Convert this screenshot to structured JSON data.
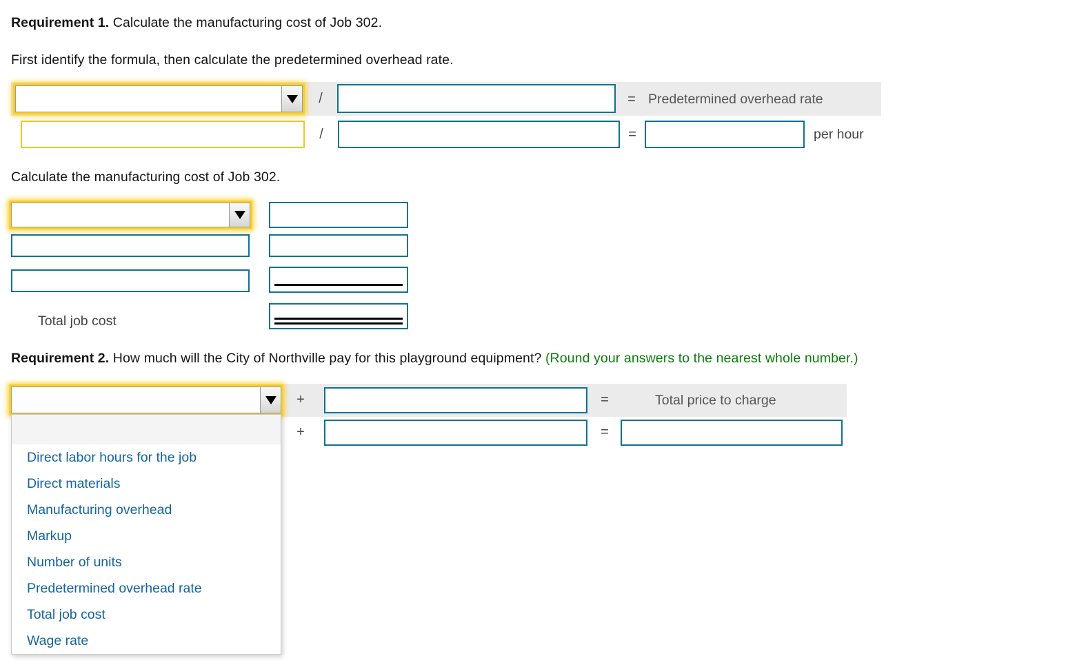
{
  "requirement1": {
    "heading_bold": "Requirement 1.",
    "heading_rest": " Calculate the manufacturing cost of Job 302.",
    "instruction": "First identify the formula, then calculate the predetermined overhead rate.",
    "formula": {
      "divide_symbol": "/",
      "equals_symbol": "=",
      "result_label": "Predetermined overhead rate",
      "unit_label": "per hour",
      "dropdown_value": "",
      "numerator_value": "",
      "denominator_value": "",
      "row2_numerator_value": "",
      "row2_denominator_value": "",
      "rate_value": ""
    },
    "cost_section": {
      "instruction": "Calculate the manufacturing cost of Job 302.",
      "rows": [
        {
          "label": "",
          "amount": ""
        },
        {
          "label": "",
          "amount": ""
        },
        {
          "label": "",
          "amount": ""
        }
      ],
      "total_label": "Total job cost",
      "total_amount": ""
    }
  },
  "requirement2": {
    "heading_bold": "Requirement 2.",
    "heading_rest": " How much will the City of Northville pay for this playground equipment? ",
    "heading_note": "(Round your answers to the nearest whole number.)",
    "plus_symbol": "+",
    "equals_symbol": "=",
    "result_label": "Total price to charge",
    "dropdown_value": "",
    "addend_value": "",
    "row2_addend1_value": "",
    "row2_addend2_value": "",
    "total_value": ""
  },
  "dropdown": {
    "open": true,
    "blank_option": "",
    "options": [
      "Direct labor hours for the job",
      "Direct materials",
      "Manufacturing overhead",
      "Markup",
      "Number of units",
      "Predetermined overhead rate",
      "Total job cost",
      "Wage rate"
    ]
  },
  "colors": {
    "input_border": "#0f7391",
    "focus_yellow": "#f7cf2e",
    "band_gray": "#ebebeb",
    "link_blue": "#1464a0",
    "note_green": "#0a7d0a"
  }
}
